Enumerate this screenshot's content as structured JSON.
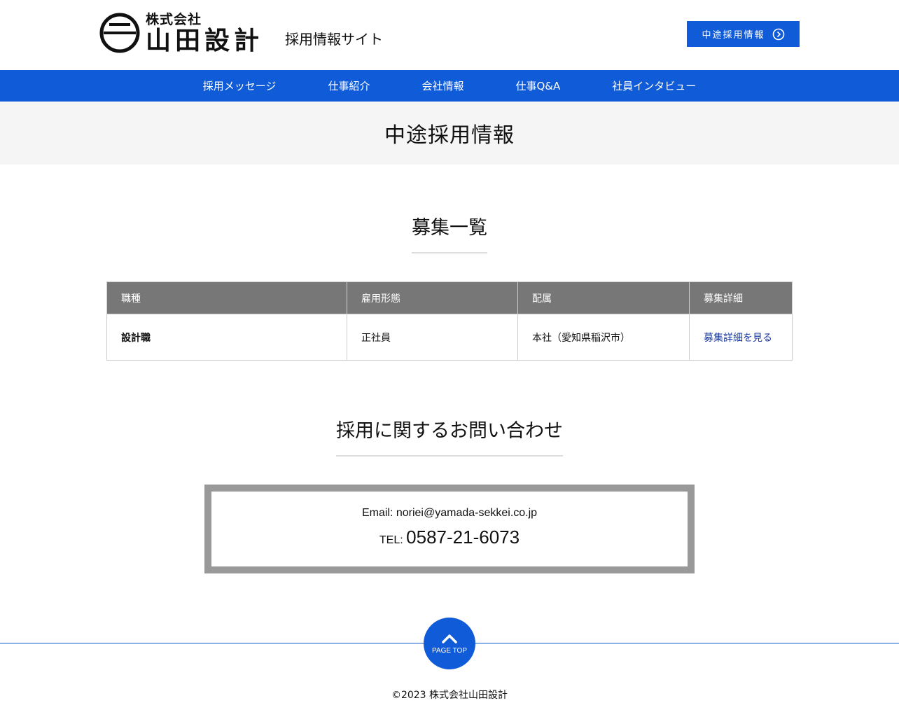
{
  "header": {
    "logo_small": "株式会社",
    "logo_large": "山田設計",
    "site_name": "採用情報サイト",
    "cta_label": "中途採用情報"
  },
  "nav": {
    "items": [
      "採用メッセージ",
      "仕事紹介",
      "会社情報",
      "仕事Q&A",
      "社員インタビュー"
    ]
  },
  "page_title": "中途採用情報",
  "recruit": {
    "heading": "募集一覧",
    "columns": [
      "職種",
      "雇用形態",
      "配属",
      "募集詳細"
    ],
    "rows": [
      {
        "job": "設計職",
        "type": "正社員",
        "location": "本社（愛知県稲沢市）",
        "link": "募集詳細を見る"
      }
    ]
  },
  "contact": {
    "heading": "採用に関するお問い合わせ",
    "email_line": "Email: noriei@yamada-sekkei.co.jp",
    "tel_label": "TEL:",
    "tel_number": "0587-21-6073"
  },
  "footer": {
    "page_top_label": "PAGE TOP",
    "copyright": "©2023 株式会社山田設計"
  },
  "colors": {
    "brand_blue": "#0f5bd8",
    "table_header": "#777777",
    "link": "#1a3a9c"
  }
}
